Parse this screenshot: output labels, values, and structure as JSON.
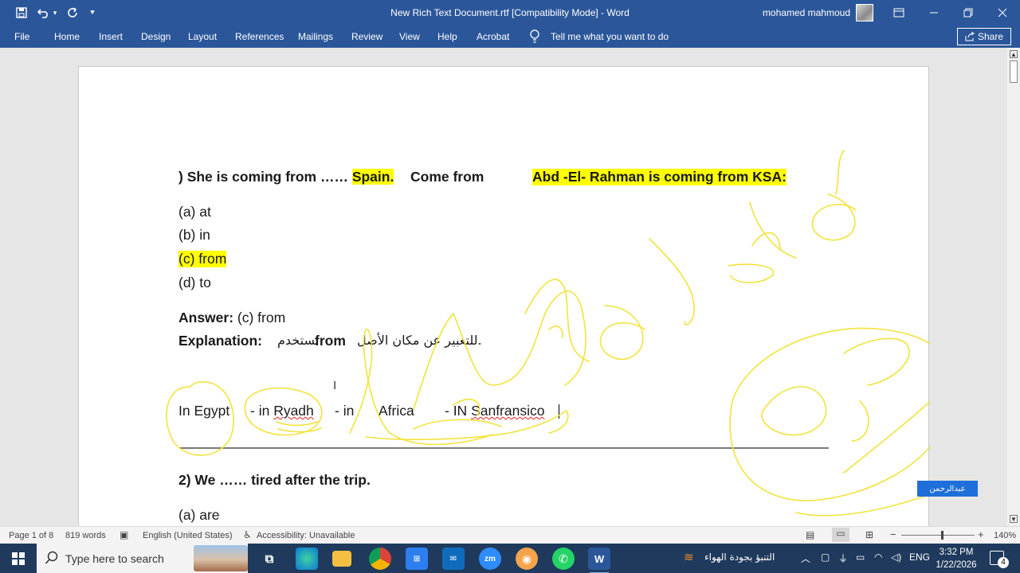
{
  "app": {
    "title": "New Rich Text Document.rtf [Compatibility Mode] - Word",
    "user_name": "mohamed mahmoud",
    "share_label": "Share"
  },
  "ribbon": {
    "tabs": [
      "File",
      "Home",
      "Insert",
      "Design",
      "Layout",
      "References",
      "Mailings",
      "Review",
      "View",
      "Help",
      "Acrobat"
    ],
    "tell_me": "Tell me what you want to do"
  },
  "document": {
    "q1": {
      "question": ") She is coming from …… ",
      "hl1": "Spain.",
      "mid": "Come from",
      "hl2": "Abd -El- Rahman is coming from KSA:"
    },
    "options": [
      "(a) at",
      "(b) in",
      "(c) from",
      "(d) to"
    ],
    "answer_label": "Answer:",
    "answer_value": " (c) from",
    "explanation_label": "Explanation:",
    "explanation_arabic_1": "نستخدم",
    "explanation_from": "from",
    "explanation_arabic_2": "للتعبير عن مكان الأصل.",
    "examples": {
      "egypt": "In Egypt",
      "in1": "- in ",
      "ryadh": "Ryadh",
      "in2": "- in",
      "africa": "Africa",
      "in3": "- IN ",
      "sanfransico": "Sanfransico"
    },
    "q2": "2) We …… tired after the trip.",
    "q2_option_a": "(a) are",
    "comment_tag": "عبدالرحمن"
  },
  "status": {
    "page": "Page 1 of 8",
    "words": "819 words",
    "language": "English (United States)",
    "accessibility": "Accessibility: Unavailable",
    "zoom": "140%",
    "zoom_level": 1.4
  },
  "taskbar": {
    "search_placeholder": "Type here to search",
    "weather_text": "التنبؤ بجودة الهواء",
    "lang": "ENG",
    "time": "3:32 PM",
    "date": "1/22/2026",
    "notification_count": "4",
    "zoom_app_label": "zm",
    "word_app_label": "W"
  },
  "colors": {
    "word_blue": "#2b579a",
    "highlight": "#ffff00",
    "ink": "#f2e33c",
    "taskbar": "#1f3a5c"
  }
}
